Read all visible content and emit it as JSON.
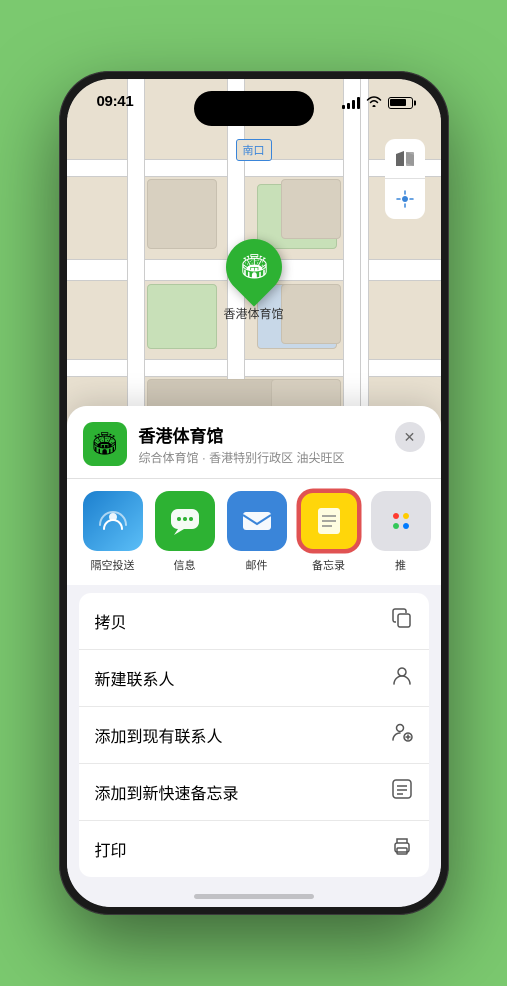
{
  "statusBar": {
    "time": "09:41",
    "locationArrow": "▶"
  },
  "mapLabels": {
    "northGate": "南口"
  },
  "venueMarker": {
    "name": "香港体育馆",
    "emoji": "🏟"
  },
  "mapButtons": {
    "mapIcon": "🗺",
    "locationIcon": "➤"
  },
  "venueCard": {
    "title": "香港体育馆",
    "subtitle": "综合体育馆 · 香港特别行政区 油尖旺区",
    "closeLabel": "✕",
    "iconEmoji": "🏟"
  },
  "shareItems": [
    {
      "id": "airdrop",
      "label": "隔空投送",
      "emoji": "📡"
    },
    {
      "id": "messages",
      "label": "信息",
      "emoji": "💬"
    },
    {
      "id": "mail",
      "label": "邮件",
      "emoji": "✉"
    },
    {
      "id": "notes",
      "label": "备忘录",
      "emoji": "📝"
    },
    {
      "id": "more",
      "label": "推"
    }
  ],
  "actionItems": [
    {
      "id": "copy",
      "label": "拷贝",
      "icon": "⧉"
    },
    {
      "id": "new-contact",
      "label": "新建联系人",
      "icon": "👤"
    },
    {
      "id": "add-contact",
      "label": "添加到现有联系人",
      "icon": "👤"
    },
    {
      "id": "quick-note",
      "label": "添加到新快速备忘录",
      "icon": "⊡"
    },
    {
      "id": "print",
      "label": "打印",
      "icon": "🖨"
    }
  ],
  "colors": {
    "accent": "#2db233",
    "background": "#7bc96f",
    "notesBorder": "#e05252"
  }
}
